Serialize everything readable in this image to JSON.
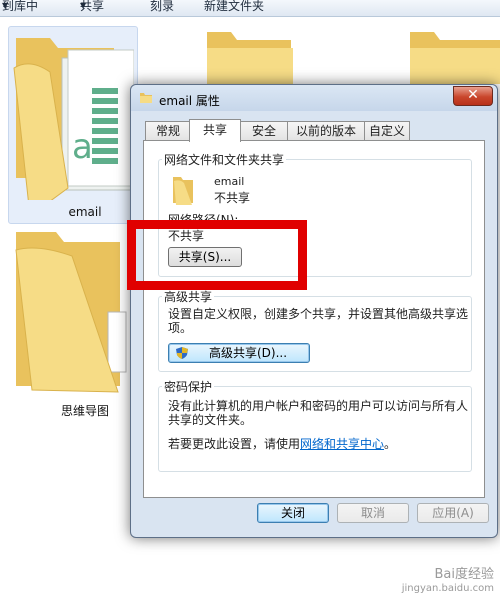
{
  "toolbar": {
    "include_library": "到库中",
    "share": "共享",
    "burn": "刻录",
    "new_folder": "新建文件夹",
    "dropdown_glyph": "▼"
  },
  "folders": {
    "email": "email",
    "mindmap": "思维导图"
  },
  "dialog": {
    "title": "email 属性",
    "close_glyph": "✕",
    "tabs": [
      "常规",
      "共享",
      "安全",
      "以前的版本",
      "自定义"
    ],
    "active_tab": "共享",
    "network_sharing": {
      "heading": "网络文件和文件夹共享",
      "folder_name": "email",
      "status": "不共享",
      "path_label": "网络路径(N):",
      "path_value": "不共享",
      "share_button": "共享(S)..."
    },
    "advanced_sharing": {
      "heading": "高级共享",
      "description_line1": "设置自定义权限，创建多个共享，并设置其他高级共享选",
      "description_line2": "项。",
      "button": "高级共享(D)..."
    },
    "password_protection": {
      "heading": "密码保护",
      "description_line1": "没有此计算机的用户帐户和密码的用户可以访问与所有人",
      "description_line2": "共享的文件夹。",
      "change_prefix": "若要更改此设置，请使用",
      "change_link": "网络和共享中心",
      "change_suffix": "。"
    },
    "buttons": {
      "close": "关闭",
      "cancel": "取消",
      "apply": "应用(A)"
    }
  },
  "watermark": {
    "line1": "Bai度经验",
    "line2": "jingyan.baidu.com"
  },
  "colors": {
    "highlight_box": "#e00000",
    "link": "#0066cc",
    "folder_yellow": "#f4d77a"
  }
}
